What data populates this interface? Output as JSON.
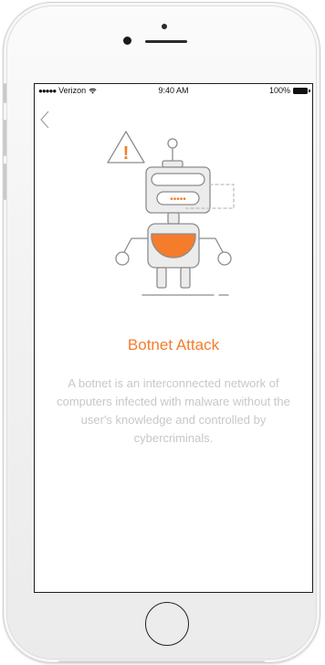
{
  "status_bar": {
    "signal": "●●●●●",
    "carrier": "Verizon",
    "time": "9:40 AM",
    "battery": "100%"
  },
  "icons": {
    "back": "chevron-left-icon",
    "wifi": "wifi-icon",
    "battery": "battery-icon",
    "illustration": "robot-warning-illustration"
  },
  "illustration": {
    "warning_mark": "!",
    "robot_mouth": "•••••"
  },
  "content": {
    "title": "Botnet Attack",
    "description": "A botnet is an interconnected network of computers infected with malware without the user's knowledge and controlled by cybercriminals."
  },
  "colors": {
    "accent": "#f57c2b",
    "description_text": "#c8c8c8",
    "illustration_stroke": "#8c8c8c",
    "illustration_fill": "#ececec"
  }
}
